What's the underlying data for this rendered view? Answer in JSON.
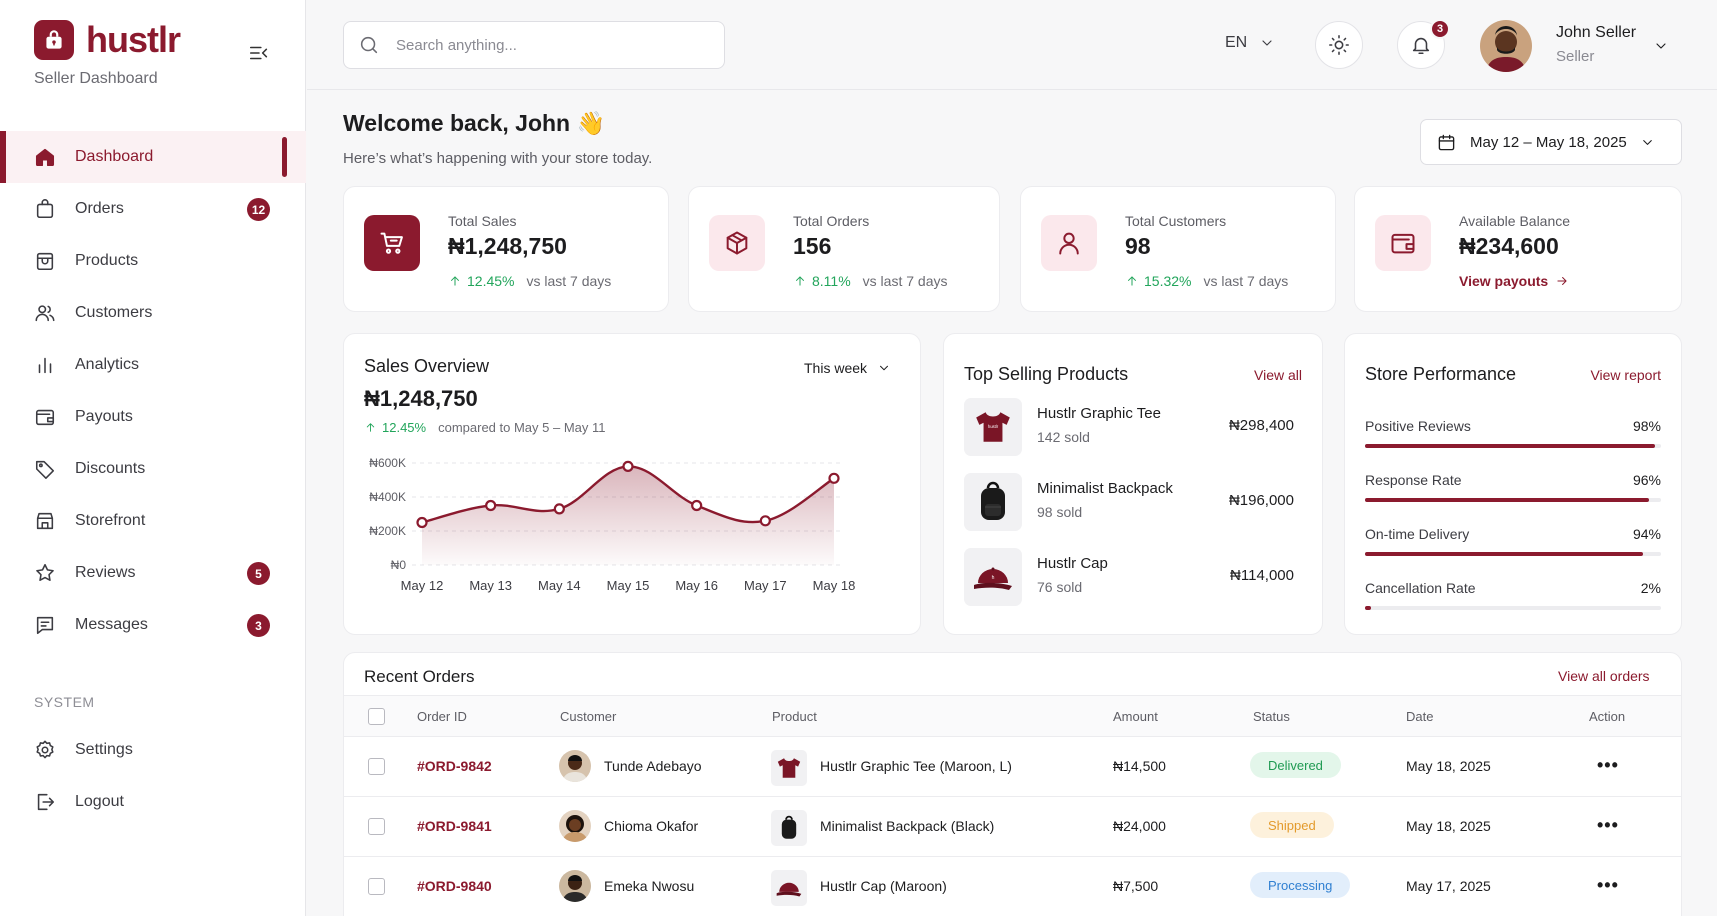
{
  "brand": {
    "name": "hustlr",
    "subtitle": "Seller Dashboard"
  },
  "sidebar": {
    "items": [
      {
        "label": "Dashboard",
        "icon": "home-icon",
        "active": true
      },
      {
        "label": "Orders",
        "icon": "shopping-bag-icon",
        "badge": "12"
      },
      {
        "label": "Products",
        "icon": "box-icon"
      },
      {
        "label": "Customers",
        "icon": "users-icon"
      },
      {
        "label": "Analytics",
        "icon": "bar-chart-icon"
      },
      {
        "label": "Payouts",
        "icon": "wallet-icon"
      },
      {
        "label": "Discounts",
        "icon": "tag-icon"
      },
      {
        "label": "Storefront",
        "icon": "store-icon"
      },
      {
        "label": "Reviews",
        "icon": "star-icon",
        "badge": "5"
      },
      {
        "label": "Messages",
        "icon": "message-icon",
        "badge": "3"
      }
    ],
    "system_label": "SYSTEM",
    "system_items": [
      {
        "label": "Settings",
        "icon": "gear-icon"
      },
      {
        "label": "Logout",
        "icon": "logout-icon"
      }
    ]
  },
  "header": {
    "search_placeholder": "Search anything...",
    "language": "EN",
    "notification_count": "3",
    "user": {
      "name": "John Seller",
      "role": "Seller"
    }
  },
  "welcome": {
    "title": "Welcome back, John 👋",
    "subtitle": "Here’s what’s happening with your store today.",
    "date_range": "May 12 – May 18, 2025"
  },
  "stats": [
    {
      "label": "Total Sales",
      "value": "₦1,248,750",
      "change": "12.45%",
      "compare": "vs last 7 days",
      "icon": "cart-icon"
    },
    {
      "label": "Total Orders",
      "value": "156",
      "change": "8.11%",
      "compare": "vs last 7 days",
      "icon": "package-icon"
    },
    {
      "label": "Total Customers",
      "value": "98",
      "change": "15.32%",
      "compare": "vs last 7 days",
      "icon": "user-icon"
    },
    {
      "label": "Available Balance",
      "value": "₦234,600",
      "link": "View payouts",
      "icon": "wallet-icon"
    }
  ],
  "sales_overview": {
    "title": "Sales Overview",
    "period": "This week",
    "total": "₦1,248,750",
    "change": "12.45%",
    "compare": "compared to May 5 – May 11"
  },
  "chart_data": {
    "type": "area",
    "categories": [
      "May 12",
      "May 13",
      "May 14",
      "May 15",
      "May 16",
      "May 17",
      "May 18"
    ],
    "values": [
      250000,
      350000,
      330000,
      580000,
      350000,
      260000,
      510000
    ],
    "yticks": [
      "₦0",
      "₦200K",
      "₦400K",
      "₦600K"
    ],
    "ylim": [
      0,
      600000
    ],
    "grid": true,
    "color": "#8b1a2e"
  },
  "top_products": {
    "title": "Top Selling Products",
    "view_all": "View all",
    "items": [
      {
        "name": "Hustlr Graphic Tee",
        "sold": "142 sold",
        "price": "₦298,400",
        "icon": "tshirt-icon"
      },
      {
        "name": "Minimalist Backpack",
        "sold": "98 sold",
        "price": "₦196,000",
        "icon": "backpack-icon"
      },
      {
        "name": "Hustlr Cap",
        "sold": "76 sold",
        "price": "₦114,000",
        "icon": "cap-icon"
      }
    ]
  },
  "performance": {
    "title": "Store Performance",
    "view_report": "View report",
    "items": [
      {
        "label": "Positive Reviews",
        "value": "98%",
        "pct": 98
      },
      {
        "label": "Response Rate",
        "value": "96%",
        "pct": 96
      },
      {
        "label": "On-time Delivery",
        "value": "94%",
        "pct": 94
      },
      {
        "label": "Cancellation Rate",
        "value": "2%",
        "pct": 2
      }
    ]
  },
  "recent_orders": {
    "title": "Recent Orders",
    "view_all": "View all orders",
    "columns": [
      "Order ID",
      "Customer",
      "Product",
      "Amount",
      "Status",
      "Date",
      "Action"
    ],
    "rows": [
      {
        "id": "#ORD-9842",
        "customer": "Tunde Adebayo",
        "product": "Hustlr Graphic Tee (Maroon, L)",
        "amount": "₦14,500",
        "status": "Delivered",
        "date": "May 18, 2025"
      },
      {
        "id": "#ORD-9841",
        "customer": "Chioma Okafor",
        "product": "Minimalist Backpack (Black)",
        "amount": "₦24,000",
        "status": "Shipped",
        "date": "May 18, 2025"
      },
      {
        "id": "#ORD-9840",
        "customer": "Emeka Nwosu",
        "product": "Hustlr Cap (Maroon)",
        "amount": "₦7,500",
        "status": "Processing",
        "date": "May 17, 2025"
      }
    ]
  },
  "colors": {
    "accent": "#8b1a2e",
    "success": "#22a55b",
    "delivered_bg": "#e3f6ea",
    "shipped_bg": "#fdf1dc",
    "processing_bg": "#e2eefb"
  }
}
